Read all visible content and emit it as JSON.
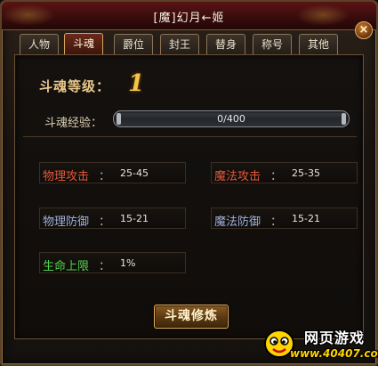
{
  "window": {
    "title": "[魔]幻月←姬",
    "close_label": "×"
  },
  "tabs": [
    {
      "label": "人物",
      "active": false
    },
    {
      "label": "斗魂",
      "active": true
    },
    {
      "label": "爵位",
      "active": false
    },
    {
      "label": "封王",
      "active": false
    },
    {
      "label": "替身",
      "active": false
    },
    {
      "label": "称号",
      "active": false
    },
    {
      "label": "其他",
      "active": false
    }
  ],
  "soul": {
    "level_label": "斗魂等级：",
    "level_value": "1",
    "exp_label": "斗魂经验：",
    "exp_text": "0/400",
    "exp_progress": 0
  },
  "stats": {
    "phys_atk": {
      "name": "物理攻击",
      "colon": "：",
      "value": "25-45"
    },
    "magic_atk": {
      "name": "魔法攻击",
      "colon": "：",
      "value": "25-35"
    },
    "phys_def": {
      "name": "物理防御",
      "colon": "：",
      "value": "15-21"
    },
    "magic_def": {
      "name": "魔法防御",
      "colon": "：",
      "value": "15-21"
    },
    "hp_cap": {
      "name": "生命上限",
      "colon": "：",
      "value": "1%"
    }
  },
  "actions": {
    "cultivate_label": "斗魂修炼"
  },
  "watermark": {
    "title": "网页游戏",
    "url": "www.40407.com"
  },
  "colors": {
    "attack_label": "#e0593b",
    "defense_label": "#9fb0d8",
    "hp_label": "#4fd44a",
    "level_value": "#f2c64a",
    "titlebar": "#5a1414"
  }
}
